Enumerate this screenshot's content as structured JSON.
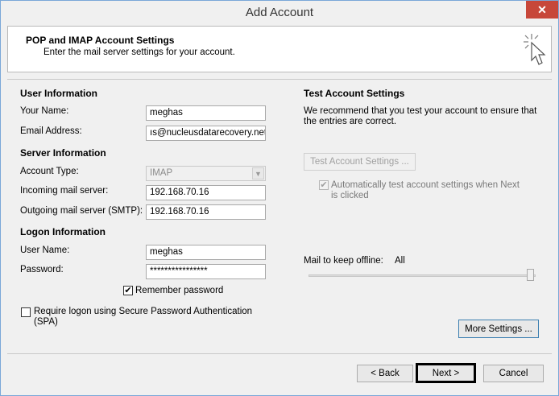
{
  "window": {
    "title": "Add Account",
    "close_label": "✕"
  },
  "header": {
    "title": "POP and IMAP Account Settings",
    "subtitle": "Enter the mail server settings for your account."
  },
  "user_info": {
    "heading": "User Information",
    "name_label": "Your Name:",
    "name_value": "meghas",
    "email_label": "Email Address:",
    "email_value": "ıs@nucleusdatarecovery.net"
  },
  "server_info": {
    "heading": "Server Information",
    "account_type_label": "Account Type:",
    "account_type_value": "IMAP",
    "incoming_label": "Incoming mail server:",
    "incoming_value": "192.168.70.16",
    "outgoing_label": "Outgoing mail server (SMTP):",
    "outgoing_value": "192.168.70.16"
  },
  "logon_info": {
    "heading": "Logon Information",
    "username_label": "User Name:",
    "username_value": "meghas",
    "password_label": "Password:",
    "password_value": "****************",
    "remember_label": "Remember password",
    "remember_checked": true,
    "spa_label_line1": "Require logon using Secure Password Authentication",
    "spa_label_line2": "(SPA)",
    "spa_checked": false
  },
  "test_settings": {
    "heading": "Test Account Settings",
    "desc_line1": "We recommend that you test your account to ensure that",
    "desc_line2": "the entries are correct.",
    "test_button": "Test Account Settings ...",
    "auto_test_line1": "Automatically test account settings when Next",
    "auto_test_line2": "is clicked",
    "auto_test_checked": true
  },
  "offline": {
    "label": "Mail to keep offline:",
    "value": "All",
    "slider_position": 1.0
  },
  "buttons": {
    "more_settings": "More Settings ...",
    "back": "< Back",
    "next": "Next >",
    "cancel": "Cancel"
  }
}
